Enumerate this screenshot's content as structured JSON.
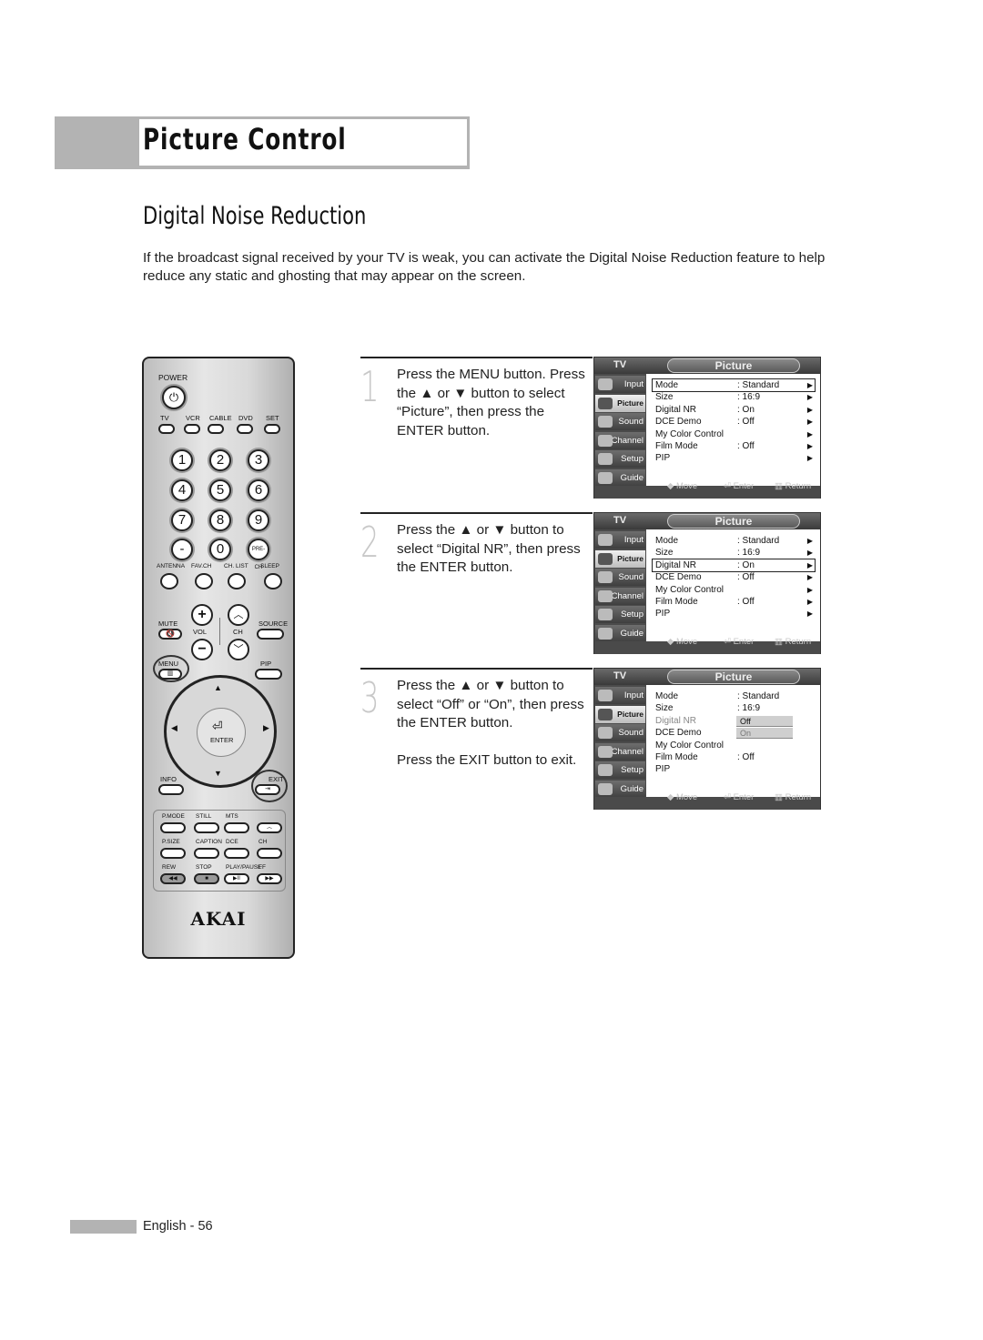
{
  "header": {
    "section": "Picture Control"
  },
  "section_title": "Digital Noise Reduction",
  "intro": "If the broadcast signal received by your TV is weak, you can activate the Digital Noise Reduction feature to help reduce any static and ghosting that may appear on the screen.",
  "steps": [
    {
      "number": "1",
      "paragraphs": [
        "Press the MENU button. Press the ▲ or ▼ button to select “Picture”, then press the ENTER button."
      ]
    },
    {
      "number": "2",
      "paragraphs": [
        "Press the ▲ or ▼ button to select “Digital NR”, then press the ENTER button."
      ]
    },
    {
      "number": "3",
      "paragraphs": [
        "Press the ▲ or ▼ button to select “Off” or “On”, then press the ENTER button.",
        "Press the EXIT button to exit."
      ]
    }
  ],
  "osd": {
    "source_label": "TV",
    "title": "Picture",
    "sidebar": [
      "Input",
      "Picture",
      "Sound",
      "Channel",
      "Setup",
      "Guide"
    ],
    "active_sidebar": "Picture",
    "footer": {
      "move": "◆ Move",
      "enter": "⏎ Enter",
      "return": "▥ Return"
    },
    "screens": [
      {
        "selected_row": "Mode",
        "rows": [
          {
            "label": "Mode",
            "value": ": Standard",
            "arrow": "▶"
          },
          {
            "label": "Size",
            "value": ": 16:9",
            "arrow": "▶"
          },
          {
            "label": "Digital NR",
            "value": ": On",
            "arrow": "▶"
          },
          {
            "label": "DCE Demo",
            "value": ": Off",
            "arrow": "▶"
          },
          {
            "label": "My Color Control",
            "value": "",
            "arrow": "▶"
          },
          {
            "label": "Film Mode",
            "value": ": Off",
            "arrow": "▶"
          },
          {
            "label": "PIP",
            "value": "",
            "arrow": "▶"
          }
        ]
      },
      {
        "selected_row": "Digital NR",
        "rows": [
          {
            "label": "Mode",
            "value": ": Standard",
            "arrow": "▶"
          },
          {
            "label": "Size",
            "value": ": 16:9",
            "arrow": "▶"
          },
          {
            "label": "Digital NR",
            "value": ": On",
            "arrow": "▶"
          },
          {
            "label": "DCE Demo",
            "value": ": Off",
            "arrow": "▶"
          },
          {
            "label": "My Color Control",
            "value": "",
            "arrow": "▶"
          },
          {
            "label": "Film Mode",
            "value": ": Off",
            "arrow": "▶"
          },
          {
            "label": "PIP",
            "value": "",
            "arrow": "▶"
          }
        ]
      },
      {
        "selected_row": "",
        "dim_row": "Digital NR",
        "rows": [
          {
            "label": "Mode",
            "value": ": Standard",
            "arrow": ""
          },
          {
            "label": "Size",
            "value": ": 16:9",
            "arrow": ""
          },
          {
            "label": "Digital NR",
            "value": "",
            "arrow": ""
          },
          {
            "label": "DCE Demo",
            "value": "",
            "arrow": ""
          },
          {
            "label": "My Color Control",
            "value": "",
            "arrow": ""
          },
          {
            "label": "Film Mode",
            "value": ": Off",
            "arrow": ""
          },
          {
            "label": "PIP",
            "value": "",
            "arrow": ""
          }
        ],
        "dropdown_options": [
          "Off",
          "On"
        ],
        "dropdown_selected": "Off"
      }
    ]
  },
  "remote": {
    "brand": "AKAI",
    "power_label": "POWER",
    "source_buttons": [
      "TV",
      "VCR",
      "CABLE",
      "DVD",
      "SET"
    ],
    "number_keys": [
      "1",
      "2",
      "3",
      "4",
      "5",
      "6",
      "7",
      "8",
      "9",
      "-",
      "0",
      "PRE-CH"
    ],
    "func_row": [
      "ANTENNA",
      "FAV.CH",
      "CH. LIST",
      "SLEEP"
    ],
    "mute_label": "MUTE",
    "vol_label": "VOL",
    "ch_label": "CH",
    "source_label": "SOURCE",
    "menu_label": "MENU",
    "pip_label": "PIP",
    "enter_label": "ENTER",
    "info_label": "INFO",
    "exit_label": "EXIT",
    "bottom_row1": [
      "P.MODE",
      "STILL",
      "MTS"
    ],
    "bottom_row2": [
      "P.SIZE",
      "CAPTION",
      "DCE",
      "CH"
    ],
    "bottom_row3": [
      "REW",
      "STOP",
      "PLAY/PAUSE",
      "FF"
    ]
  },
  "footer": {
    "page": "English - 56"
  }
}
